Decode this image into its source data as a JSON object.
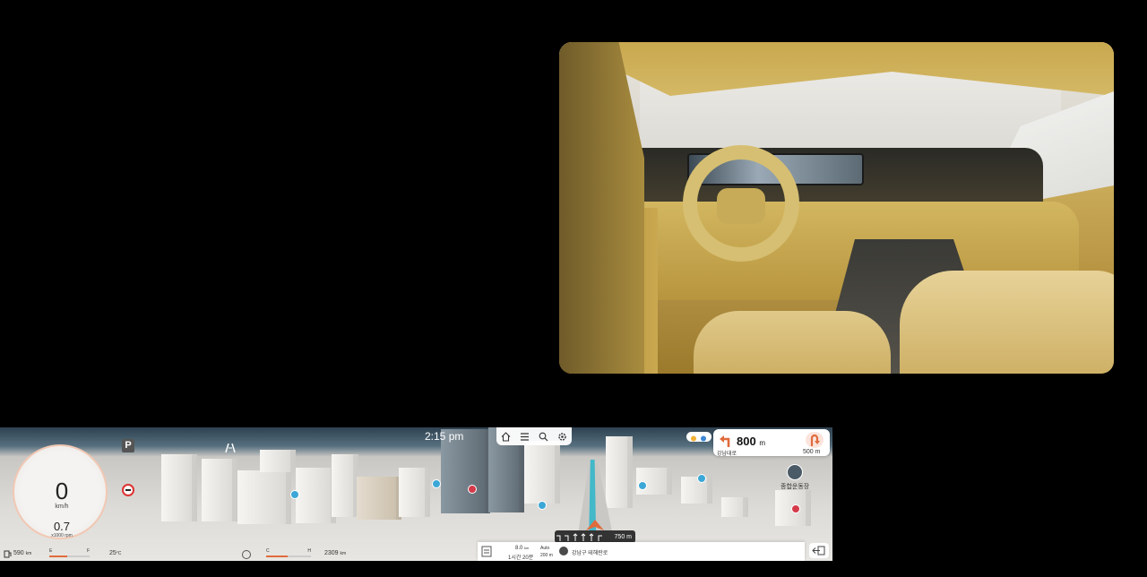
{
  "cluster": {
    "clock": "2:15 pm",
    "gear": "P",
    "speed": {
      "value": "0",
      "unit": "km/h"
    },
    "rpm": {
      "value": "0.7",
      "unit": "x1000 rpm"
    },
    "fuel": {
      "empty": "E",
      "full": "F",
      "range": "590",
      "range_unit": "km"
    },
    "coolant": {
      "cold": "C",
      "hot": "H"
    },
    "outside_temp": "25",
    "outside_temp_unit": "°C",
    "odometer": "2309",
    "odometer_unit": "km"
  },
  "navigation": {
    "turn": {
      "distance": "800",
      "unit": "m",
      "road": "강남대로"
    },
    "next_turn": {
      "distance": "500 m"
    },
    "lane_guide": {
      "distance": "750 m"
    },
    "place_label": "종합운동장",
    "route": {
      "remaining_distance": "8.0",
      "remaining_distance_unit": "km",
      "remaining_time": "1시간 20분",
      "scale_mode": "Auto",
      "scale": "200 m",
      "current_location": "강남구 테헤란로"
    },
    "colors": {
      "route": "#42b8c8",
      "turn_accent": "#e06b3c"
    }
  }
}
